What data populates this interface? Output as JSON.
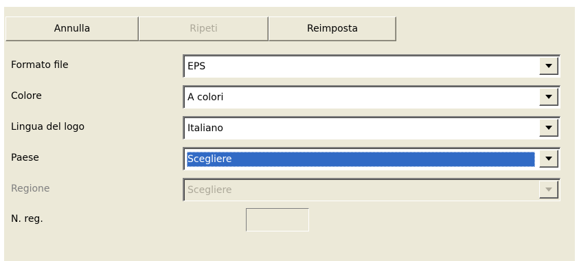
{
  "toolbar": {
    "undo_label": "Annulla",
    "redo_label": "Ripeti",
    "reset_label": "Reimposta"
  },
  "form": {
    "file_format": {
      "label": "Formato file",
      "value": "EPS"
    },
    "color": {
      "label": "Colore",
      "value": "A colori"
    },
    "logo_language": {
      "label": "Lingua del logo",
      "value": "Italiano"
    },
    "country": {
      "label": "Paese",
      "value": "Scegliere"
    },
    "region": {
      "label": "Regione",
      "value": "Scegliere"
    },
    "reg_number": {
      "label": "N. reg.",
      "value": ""
    }
  },
  "colors": {
    "panel_bg": "#ece9d8",
    "selection": "#316ac5",
    "disabled_text": "#aca899"
  },
  "icons": {
    "dropdown": "triangle-down-icon"
  }
}
